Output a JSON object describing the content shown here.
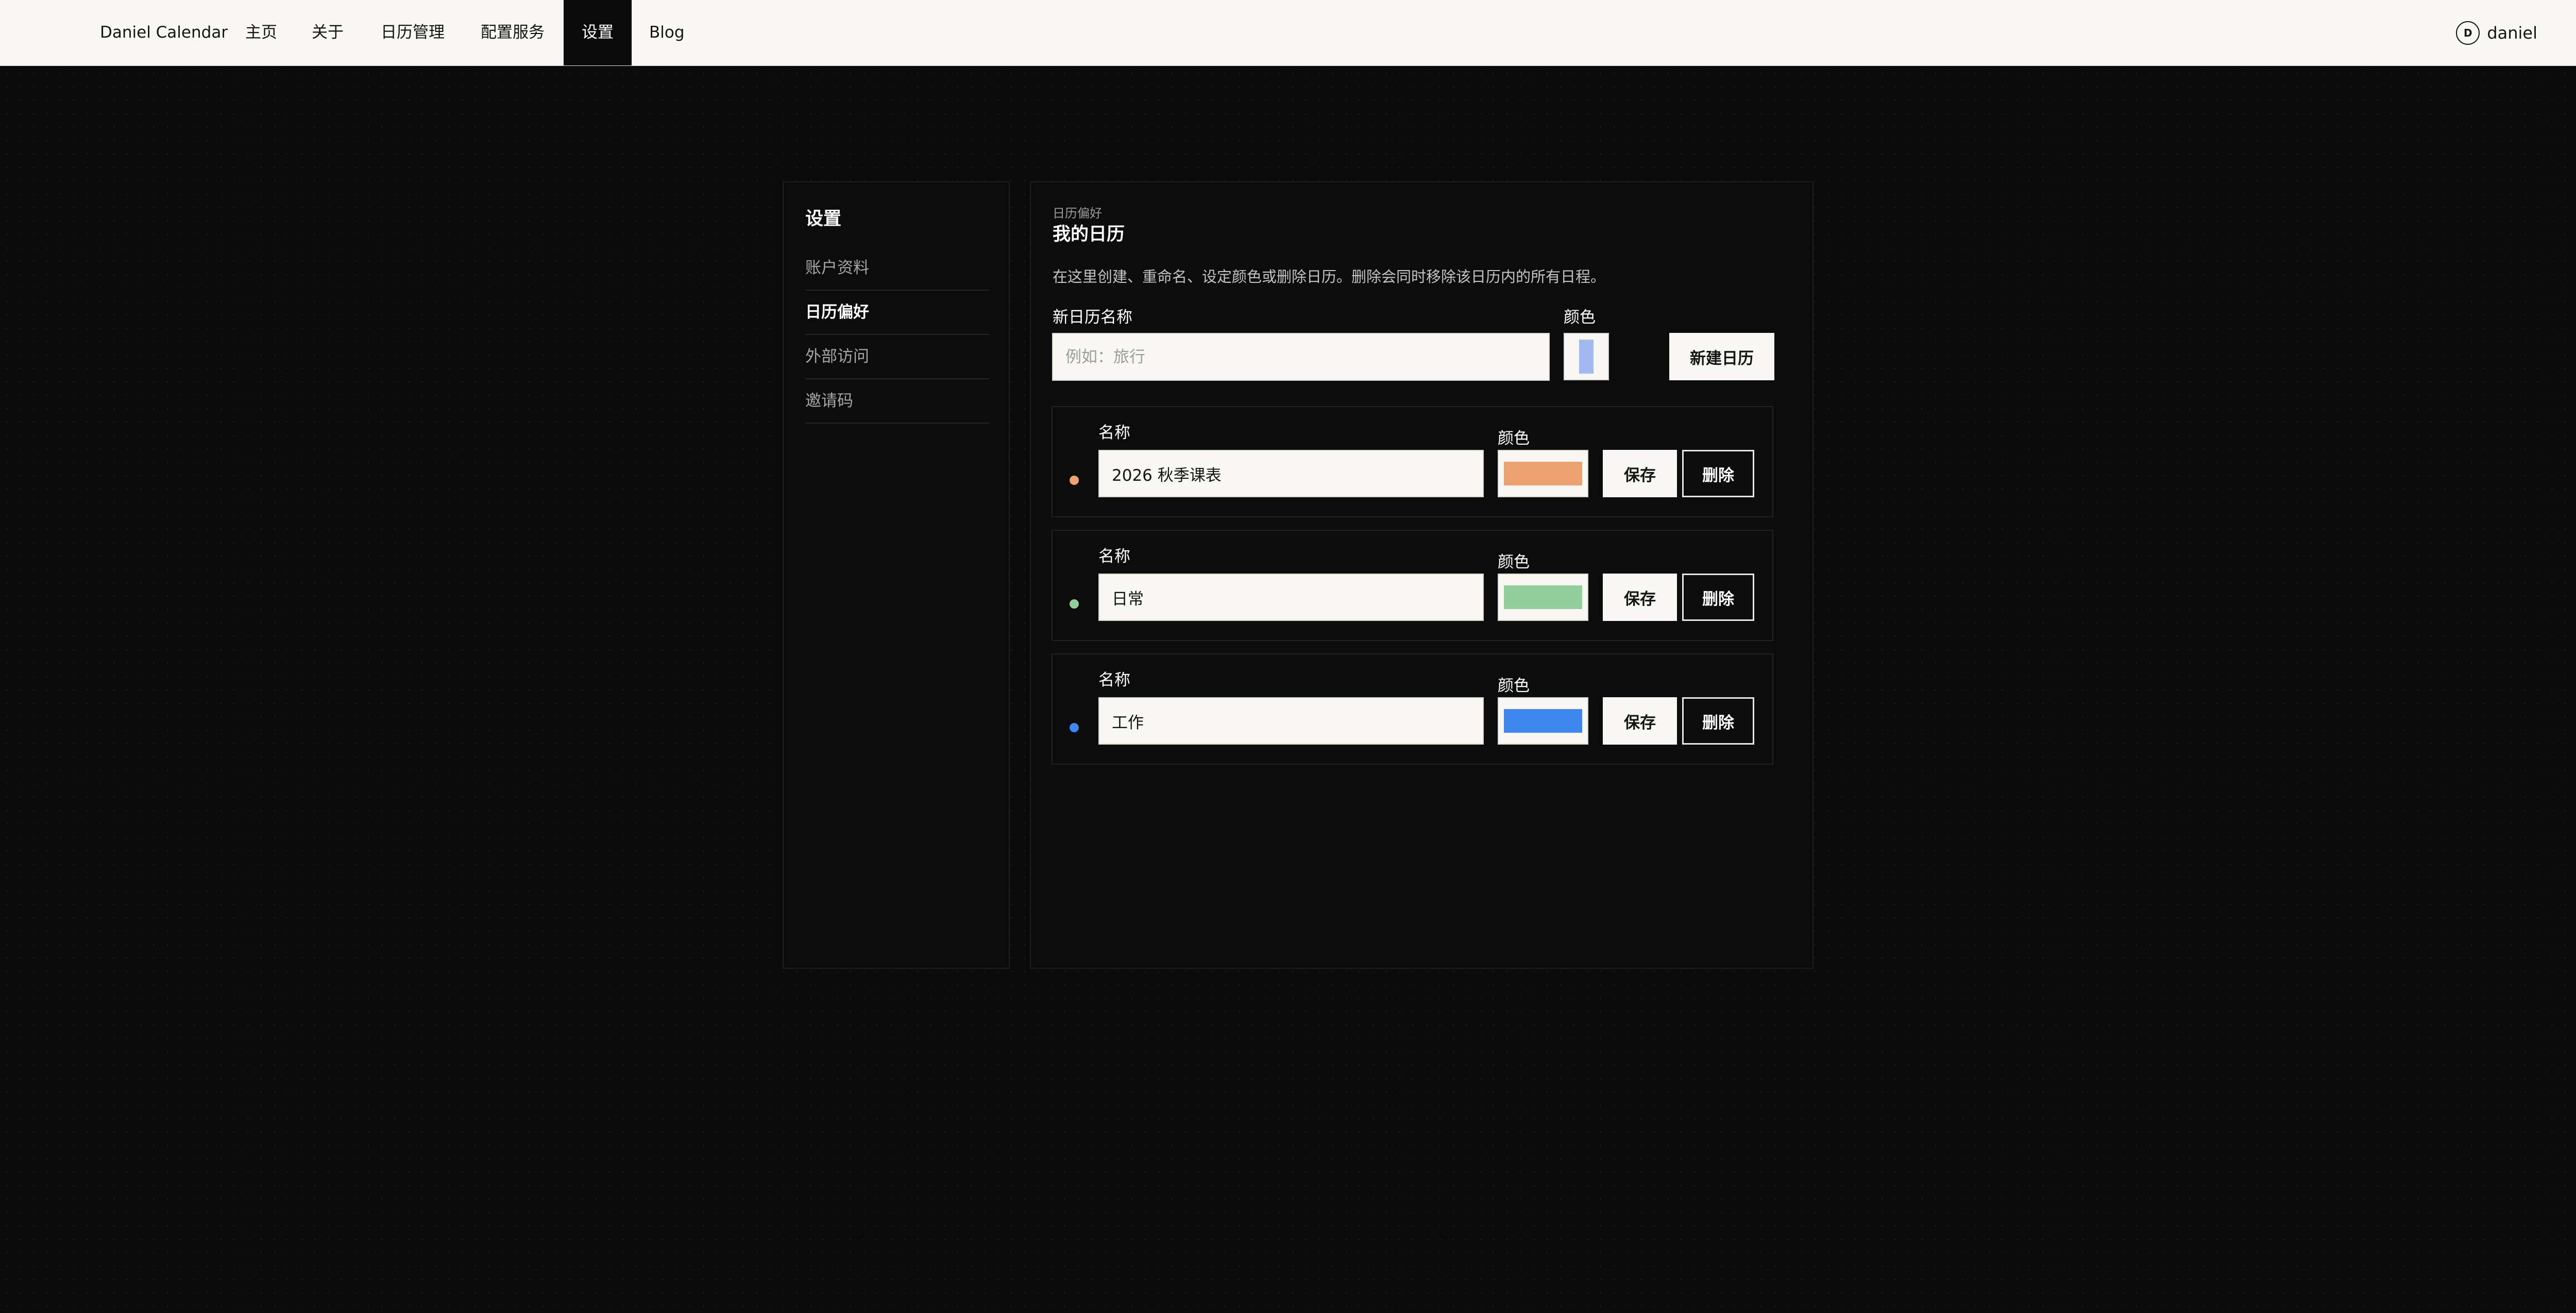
{
  "nav": {
    "brand": "Daniel Calendar",
    "items": [
      {
        "label": "主页"
      },
      {
        "label": "关于"
      },
      {
        "label": "日历管理"
      },
      {
        "label": "配置服务"
      },
      {
        "label": "设置"
      },
      {
        "label": "Blog"
      }
    ],
    "active_item": "设置",
    "user": {
      "initial": "D",
      "name": "daniel"
    }
  },
  "sidebar": {
    "title": "设置",
    "items": [
      {
        "label": "账户资料"
      },
      {
        "label": "日历偏好"
      },
      {
        "label": "外部访问"
      },
      {
        "label": "邀请码"
      }
    ],
    "active_item": "日历偏好"
  },
  "main": {
    "eyebrow": "日历偏好",
    "title": "我的日历",
    "description": "在这里创建、重命名、设定颜色或删除日历。删除会同时移除该日历内的所有日程。",
    "new_calendar": {
      "name_label": "新日历名称",
      "name_placeholder": "例如：旅行",
      "name_value": "",
      "color_label": "颜色",
      "color": "#a3b8ef",
      "create_button": "新建日历"
    },
    "calendars": [
      {
        "name_label": "名称",
        "name": "2026 秋季课表",
        "color_label": "颜色",
        "color": "#eca16e",
        "save_button": "保存",
        "delete_button": "删除"
      },
      {
        "name_label": "名称",
        "name": "日常",
        "color_label": "颜色",
        "color": "#92cf9c",
        "save_button": "保存",
        "delete_button": "删除"
      },
      {
        "name_label": "名称",
        "name": "工作",
        "color_label": "颜色",
        "color": "#3d87ed",
        "save_button": "保存",
        "delete_button": "删除"
      }
    ]
  },
  "colors": {
    "page_bg": "#0b0b0b",
    "topbar_bg": "#f8f7f3",
    "panel_bg": "#0c0c0c",
    "text_primary": "#ffffff",
    "text_muted": "#a6a6a6"
  }
}
